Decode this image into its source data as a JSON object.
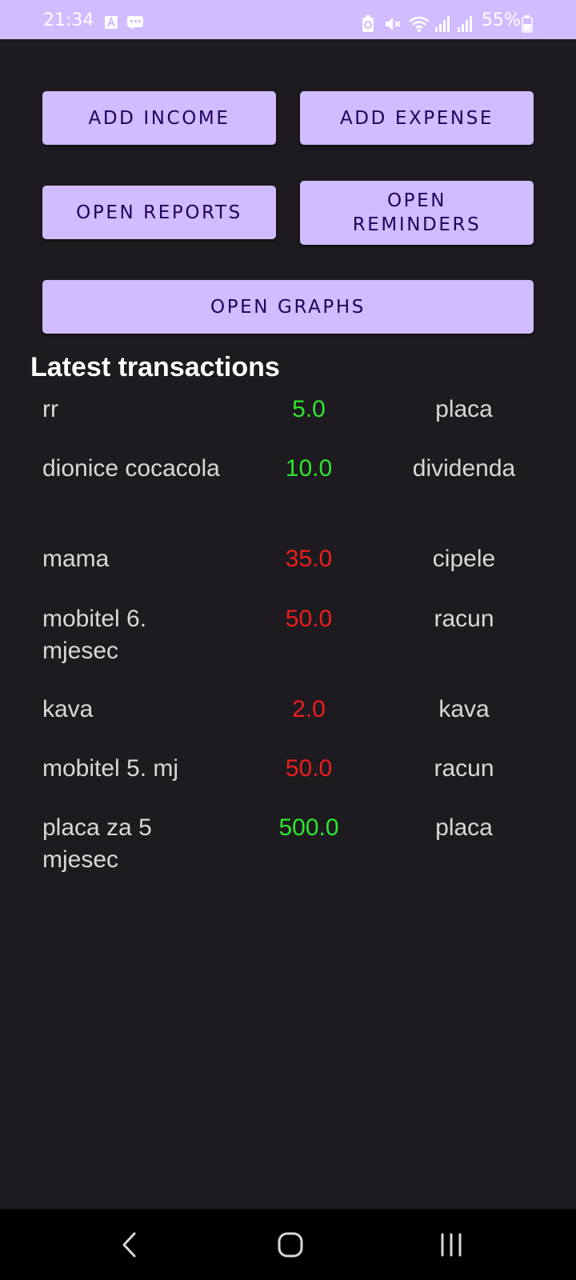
{
  "status_bar": {
    "time": "21:34",
    "battery_text": "55%",
    "icons": [
      "auto-a-icon",
      "chat-icon",
      "battery-saver-icon",
      "mute-icon",
      "wifi-icon",
      "signal-icon",
      "signal-2-icon",
      "battery-icon"
    ]
  },
  "buttons": {
    "add_income": "ADD INCOME",
    "add_expense": "ADD EXPENSE",
    "open_reports": "OPEN REPORTS",
    "open_reminders": "OPEN REMINDERS",
    "open_graphs": "OPEN GRAPHS"
  },
  "transactions": {
    "title": "Latest transactions",
    "colors": {
      "income": "#2ee62e",
      "expense": "#ee1c1c"
    },
    "items": [
      {
        "name": "rr",
        "amount": "5.0",
        "category": "placa",
        "type": "income"
      },
      {
        "name": "dionice cocacola",
        "amount": "10.0",
        "category": "dividenda",
        "type": "income"
      },
      {
        "name": "mama",
        "amount": "35.0",
        "category": "cipele",
        "type": "expense"
      },
      {
        "name": "mobitel 6. mjesec",
        "amount": "50.0",
        "category": "racun",
        "type": "expense"
      },
      {
        "name": "kava",
        "amount": "2.0",
        "category": "kava",
        "type": "expense"
      },
      {
        "name": "mobitel 5. mj",
        "amount": "50.0",
        "category": "racun",
        "type": "expense"
      },
      {
        "name": "placa za 5 mjesec",
        "amount": "500.0",
        "category": "placa",
        "type": "income"
      }
    ]
  },
  "nav": {
    "icons": [
      "back-icon",
      "home-icon",
      "recents-icon"
    ]
  },
  "colors": {
    "accent": "#d0bcff",
    "on_accent": "#21005d",
    "background": "#1d1b20"
  }
}
